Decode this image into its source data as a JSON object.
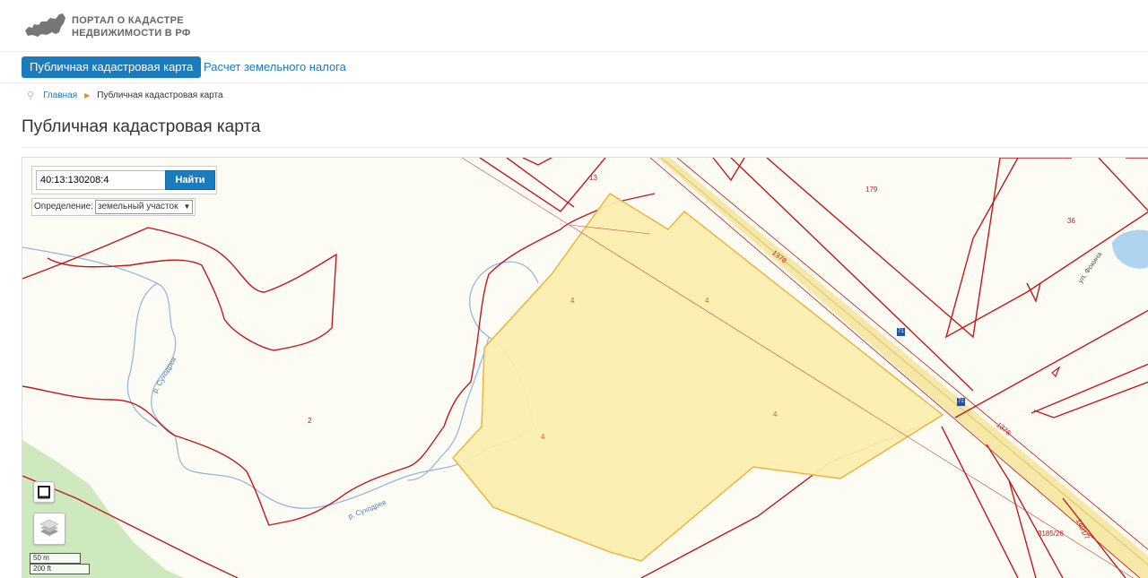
{
  "header": {
    "logo_line1": "ПОРТАЛ О КАДАСТРЕ",
    "logo_line2": "НЕДВИЖИМОСТИ В РФ"
  },
  "nav": {
    "tab_active": "Публичная кадастровая карта",
    "tab_tax": "Расчет земельного налога"
  },
  "breadcrumb": {
    "home": "Главная",
    "current": "Публичная кадастровая карта"
  },
  "page_title": "Публичная кадастровая карта",
  "map": {
    "search_value": "40:13:130208:4",
    "search_button": "Найти",
    "definition_label": "Определение:",
    "definition_value": "земельный участок",
    "scale_metric": "50 m",
    "scale_imperial": "200 ft",
    "labels": {
      "n13": "13",
      "n179": "179",
      "n36": "36",
      "n1378a": "1378",
      "n1378b": "1378",
      "n2": "2",
      "n4a": "4",
      "n4b": "4",
      "n4c": "4",
      "n4d": "4",
      "n3185": "3185/26",
      "n1401": "1401/7",
      "road_a": "71",
      "road_b": "71"
    },
    "street_labels": {
      "river_a": "р. Суходрев",
      "river_b": "р. Суходрев",
      "street": "ул. Фокина"
    },
    "colors": {
      "parcel_border": "#c0191d",
      "selected_fill": "#fbeeb0",
      "selected_border": "#f0b030",
      "road": "#f4e6a8",
      "river": "#8fb4dc",
      "water": "#a8d0f0",
      "green": "#c8e8b8"
    }
  }
}
